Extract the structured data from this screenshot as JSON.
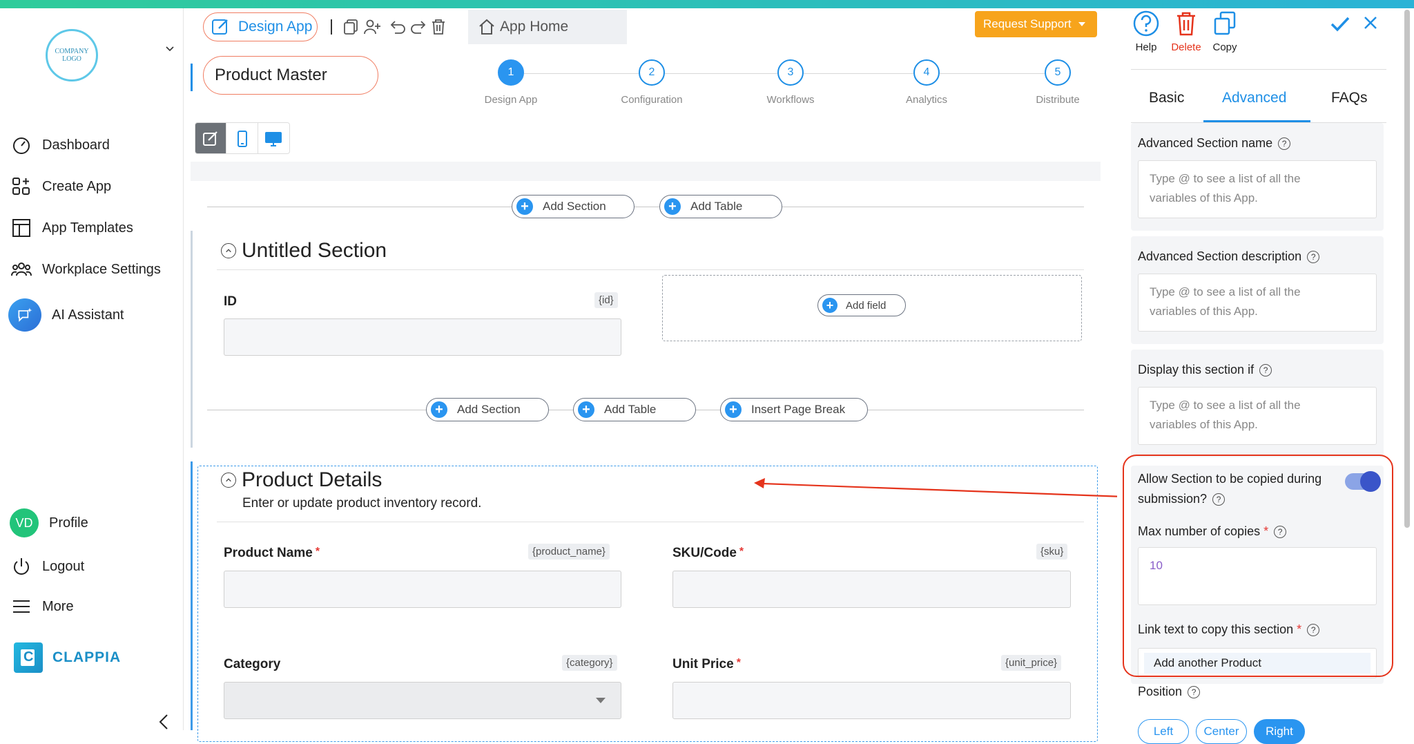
{
  "colors": {
    "accent": "#2a95f0",
    "support": "#f7a41c",
    "danger": "#e5341c",
    "top_gradient_start": "#2ecc9a",
    "top_gradient_end": "#2bb3d6"
  },
  "sidebar": {
    "logo_text": "COMPANY LOGO",
    "items": [
      {
        "label": "Dashboard",
        "icon": "gauge-icon"
      },
      {
        "label": "Create App",
        "icon": "grid-plus-icon"
      },
      {
        "label": "App Templates",
        "icon": "template-icon"
      },
      {
        "label": "Workplace Settings",
        "icon": "users-icon"
      },
      {
        "label": "AI Assistant",
        "icon": "ai-assistant-icon"
      }
    ],
    "profile_initials": "VD",
    "profile_label": "Profile",
    "logout_label": "Logout",
    "more_label": "More",
    "brand_name": "CLAPPIA"
  },
  "header": {
    "design_app_label": "Design App",
    "app_home_label": "App Home",
    "request_support_label": "Request Support",
    "app_name": "Product Master"
  },
  "steps": [
    {
      "num": "1",
      "label": "Design App"
    },
    {
      "num": "2",
      "label": "Configuration"
    },
    {
      "num": "3",
      "label": "Workflows"
    },
    {
      "num": "4",
      "label": "Analytics"
    },
    {
      "num": "5",
      "label": "Distribute"
    }
  ],
  "canvas": {
    "add_section": "Add Section",
    "add_table": "Add Table",
    "insert_page_break": "Insert Page Break",
    "add_field": "Add field",
    "section1": {
      "title": "Untitled Section",
      "field_label": "ID",
      "field_var": "{id}"
    },
    "section2": {
      "title": "Product Details",
      "description": "Enter or update product inventory record.",
      "fields": [
        {
          "label": "Product Name",
          "var": "{product_name}"
        },
        {
          "label": "SKU/Code",
          "var": "{sku}"
        },
        {
          "label": "Category",
          "var": "{category}"
        },
        {
          "label": "Unit Price",
          "var": "{unit_price}"
        }
      ]
    }
  },
  "panel": {
    "help": "Help",
    "delete": "Delete",
    "copy": "Copy",
    "tabs": [
      "Basic",
      "Advanced",
      "FAQs"
    ],
    "adv_name_label": "Advanced Section name",
    "adv_desc_label": "Advanced Section description",
    "display_if_label": "Display this section if",
    "placeholder_line1": "Type @ to see a list of all the",
    "placeholder_line2": "variables of this App.",
    "allow_copy_line1": "Allow Section to be copied during",
    "allow_copy_line2": "submission?",
    "max_copies_label": "Max number of copies",
    "max_copies_value": "10",
    "link_text_label": "Link text to copy this section",
    "link_text_value": "Add another Product",
    "position_label": "Position",
    "positions": [
      "Left",
      "Center",
      "Right"
    ],
    "q": "?"
  }
}
